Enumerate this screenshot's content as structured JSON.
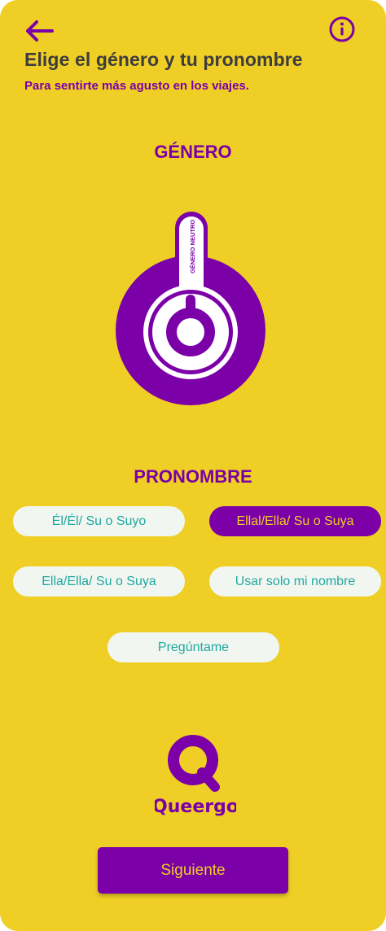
{
  "header": {
    "back_icon": "arrow-left-icon",
    "info_icon": "info-circle-icon",
    "title": "Elige el género y tu pronombre",
    "subtitle": "Para sentirte más agusto en los viajes."
  },
  "gender": {
    "heading": "GÉNERO",
    "icon": "gender-neutral-symbol-icon",
    "icon_label": "GÉNERO NEUTRO"
  },
  "pronouns": {
    "heading": "PRONOMBRE",
    "options": [
      {
        "label": "Él/Él/ Su o Suyo",
        "selected": false
      },
      {
        "label": "Ellal/Ella/ Su o Suya",
        "selected": true
      },
      {
        "label": "Ella/Ella/ Su o Suya",
        "selected": false
      },
      {
        "label": "Usar solo mi nombre",
        "selected": false
      },
      {
        "label": "Pregúntame",
        "selected": false
      }
    ]
  },
  "brand": {
    "logo_icon": "queergo-q-logo-icon",
    "name": "Queergo"
  },
  "footer": {
    "next_label": "Siguiente"
  },
  "colors": {
    "background": "#EFCF25",
    "accent": "#7B00A8",
    "title_text": "#3D3D3D",
    "pill_bg": "#F2F6F1",
    "pill_text": "#1FA8A0"
  }
}
